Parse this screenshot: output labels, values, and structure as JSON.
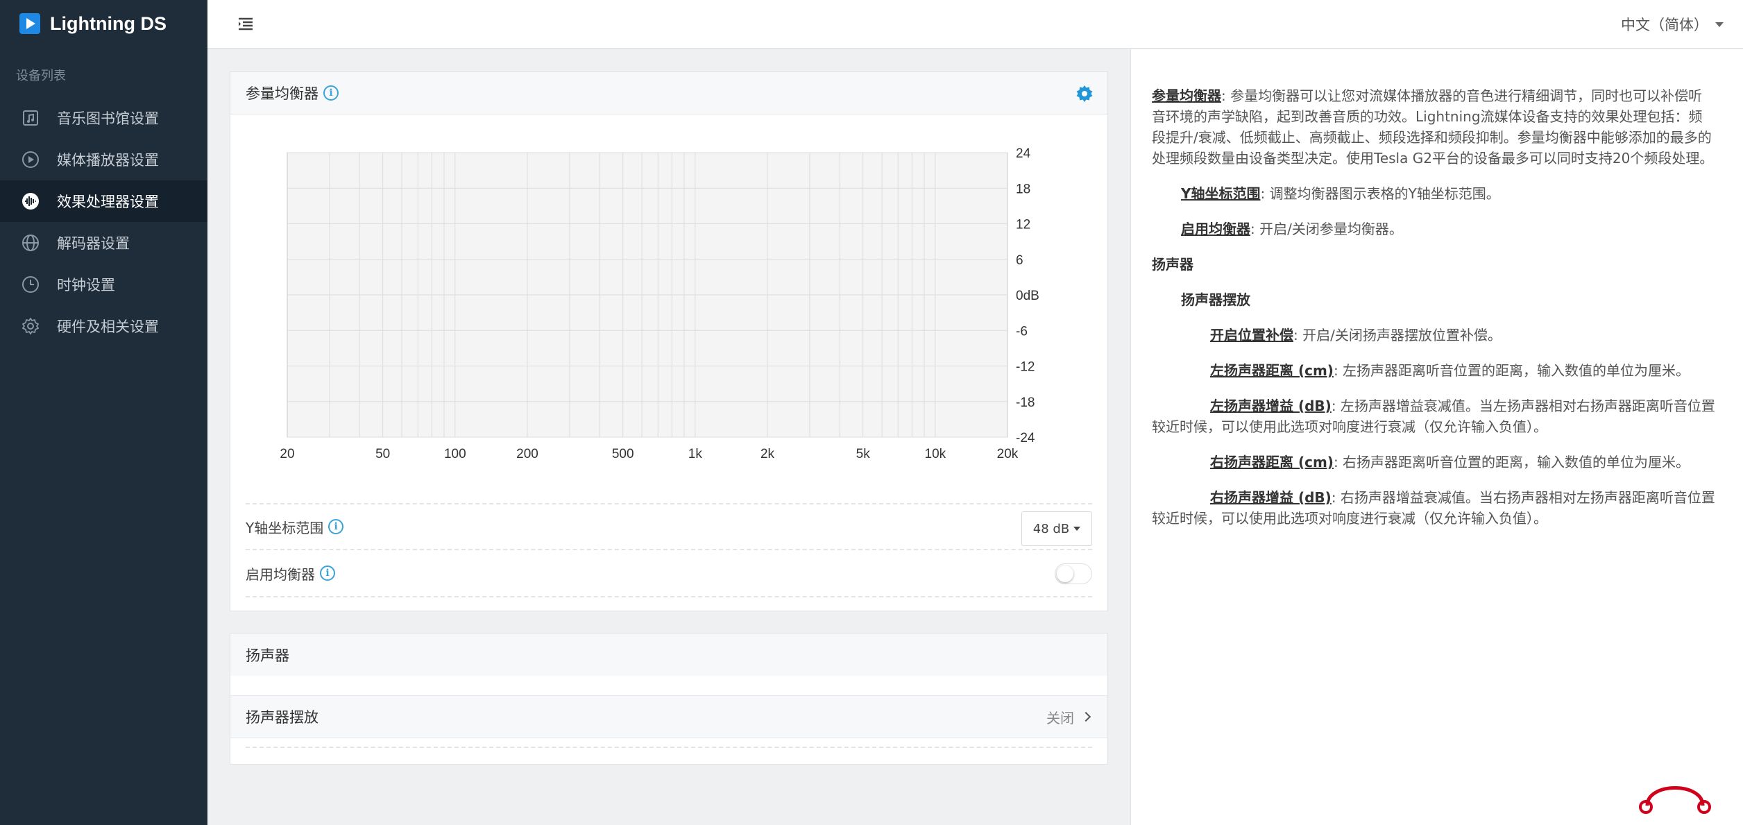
{
  "brand": {
    "title": "Lightning DS"
  },
  "sidebar": {
    "caption": "设备列表",
    "items": [
      {
        "label": "音乐图书馆设置",
        "icon": "music-library-icon"
      },
      {
        "label": "媒体播放器设置",
        "icon": "play-circle-icon"
      },
      {
        "label": "效果处理器设置",
        "icon": "waveform-icon",
        "active": true
      },
      {
        "label": "解码器设置",
        "icon": "globe-icon"
      },
      {
        "label": "时钟设置",
        "icon": "clock-icon"
      },
      {
        "label": "硬件及相关设置",
        "icon": "gear-icon"
      }
    ]
  },
  "topbar": {
    "language": "中文（简体）"
  },
  "equalizer": {
    "title": "参量均衡器",
    "yaxis_label": "Y轴坐标范围",
    "yaxis_value": "48 dB",
    "enable_label": "启用均衡器",
    "enabled": false
  },
  "chart_data": {
    "type": "line",
    "xscale": "log",
    "xlim": [
      20,
      20000
    ],
    "ylim": [
      -24,
      24
    ],
    "xticks": [
      "20",
      "50",
      "100",
      "200",
      "500",
      "1k",
      "2k",
      "5k",
      "10k",
      "20k"
    ],
    "xtick_values": [
      20,
      50,
      100,
      200,
      500,
      1000,
      2000,
      5000,
      10000,
      20000
    ],
    "yticks": [
      "24",
      "18",
      "12",
      "6",
      "0dB",
      "-6",
      "-12",
      "-18",
      "-24"
    ],
    "ytick_values": [
      24,
      18,
      12,
      6,
      0,
      -6,
      -12,
      -18,
      -24
    ],
    "grid": true,
    "series": []
  },
  "speaker": {
    "title": "扬声器",
    "placement_label": "扬声器摆放",
    "placement_state": "关闭"
  },
  "help": {
    "eq_term": "参量均衡器",
    "eq_text": ": 参量均衡器可以让您对流媒体播放器的音色进行精细调节，同时也可以补偿听音环境的声学缺陷，起到改善音质的功效。Lightning流媒体设备支持的效果处理包括：频段提升/衰减、低频截止、高频截止、频段选择和频段抑制。参量均衡器中能够添加的最多的处理频段数量由设备类型决定。使用Tesla G2平台的设备最多可以同时支持20个频段处理。",
    "yaxis_term": "Y轴坐标范围",
    "yaxis_text": ": 调整均衡器图示表格的Y轴坐标范围。",
    "enable_term": "启用均衡器",
    "enable_text": ": 开启/关闭参量均衡器。",
    "speaker_heading": "扬声器",
    "placement_heading": "扬声器摆放",
    "comp_term": "开启位置补偿",
    "comp_text": ": 开启/关闭扬声器摆放位置补偿。",
    "left_dist_term": "左扬声器距离 (cm)",
    "left_dist_text": ": 左扬声器距离听音位置的距离，输入数值的单位为厘米。",
    "left_gain_term": "左扬声器增益 (dB)",
    "left_gain_text": ": 左扬声器增益衰减值。当左扬声器相对右扬声器距离听音位置较近时候，可以使用此选项对响度进行衰减（仅允许输入负值）。",
    "right_dist_term": "右扬声器距离 (cm)",
    "right_dist_text": ": 右扬声器距离听音位置的距离，输入数值的单位为厘米。",
    "right_gain_term": "右扬声器增益 (dB)",
    "right_gain_text": ": 右扬声器增益衰减值。当右扬声器相对左扬声器距离听音位置较近时候，可以使用此选项对响度进行衰减（仅允许输入负值）。"
  },
  "colors": {
    "accent": "#3aa3d9",
    "sidebar_bg": "#1f2d3a",
    "brand_blue": "#1e88e5",
    "logo_red": "#d0021b"
  }
}
